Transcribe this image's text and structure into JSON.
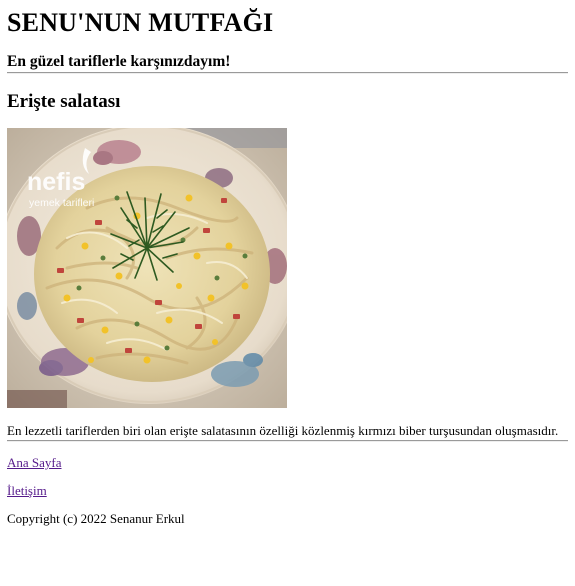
{
  "header": {
    "title": "SENU'NUN MUTFAĞI",
    "tagline": "En güzel tariflerle karşınızdayım!"
  },
  "recipe": {
    "title": "Erişte salatası",
    "image": {
      "watermark_brand": "nefis",
      "watermark_sub": "yemek tarifleri"
    },
    "description": "En lezzetli tariflerden biri olan erişte salatasının özelliği közlenmiş kırmızı biber turşusundan oluşmasıdır."
  },
  "footer": {
    "links": {
      "home": "Ana Sayfa",
      "contact": "İletişim"
    },
    "copyright": "Copyright (c) 2022 Senanur Erkul"
  },
  "colors": {
    "visited_link": "#551a8b",
    "rule": "#9a9a9a"
  }
}
